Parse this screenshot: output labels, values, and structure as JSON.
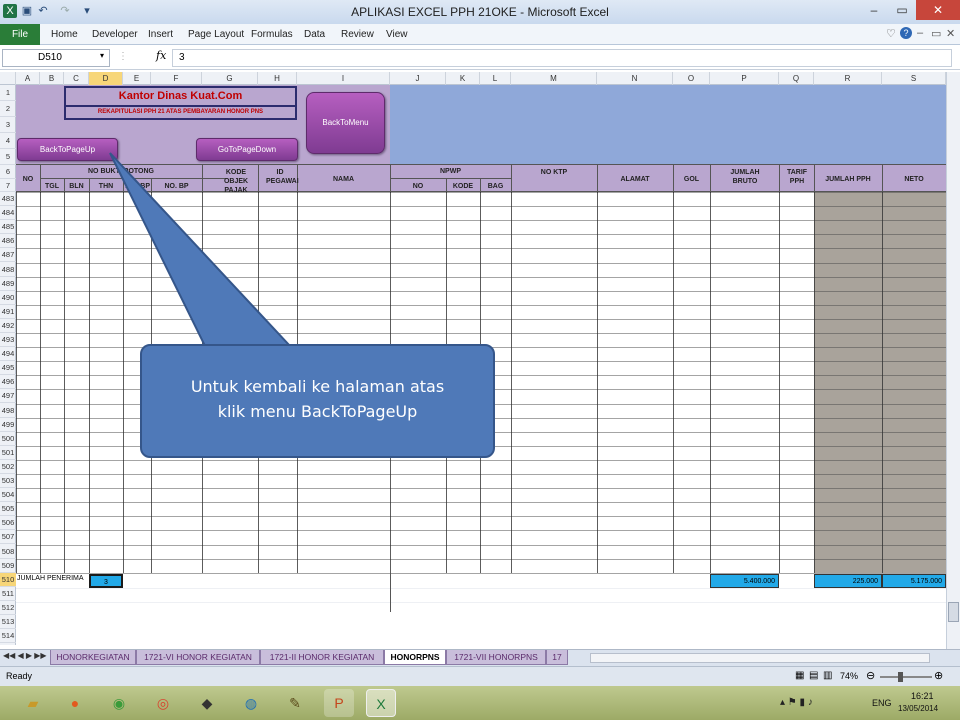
{
  "window": {
    "title": "APLIKASI EXCEL PPH 21OKE - Microsoft Excel",
    "minimize": "–",
    "restore": "▭",
    "close": "✕"
  },
  "ribbon": {
    "file": "File",
    "tabs": [
      "Home",
      "Developer",
      "Insert",
      "Page Layout",
      "Formulas",
      "Data",
      "Review",
      "View"
    ]
  },
  "formula_bar": {
    "name_box": "D510",
    "fx": "fx",
    "value": "3"
  },
  "columns": [
    "A",
    "B",
    "C",
    "D",
    "E",
    "F",
    "G",
    "H",
    "I",
    "J",
    "K",
    "L",
    "M",
    "N",
    "O",
    "P",
    "Q",
    "R",
    "S"
  ],
  "rows": [
    "1",
    "2",
    "3",
    "4",
    "5",
    "6",
    "7",
    "483",
    "484",
    "485",
    "486",
    "487",
    "488",
    "489",
    "490",
    "491",
    "492",
    "493",
    "494",
    "495",
    "496",
    "497",
    "498",
    "499",
    "500",
    "501",
    "502",
    "503",
    "504",
    "505",
    "506",
    "507",
    "508",
    "509",
    "510",
    "511",
    "512",
    "513",
    "514"
  ],
  "sheet": {
    "kantor": "Kantor Dinas Kuat.Com",
    "rekap": "REKAPITULASI PPH 21 ATAS PEMBAYARAN HONOR PNS",
    "btn_backtomenu": "BackToMenu",
    "btn_backtopageup": "BackToPageUp",
    "btn_gotopagedown": "GoToPageDown",
    "headers": {
      "no": "NO",
      "bukti_potong": "NO BUKTI POTONG",
      "tgl": "TGL",
      "bln": "BLN",
      "thn": "THN",
      "thn_bp": "THN.BP",
      "no_bp": "NO. BP",
      "kode_objek": "KODE OBJEK PAJAK",
      "id_pegawai": "ID PEGAWAI",
      "nama": "NAMA",
      "npwp": "NPWP",
      "npwp_no": "NO",
      "npwp_kode": "KODE",
      "npwp_bag": "BAG",
      "no_ktp": "NO KTP",
      "alamat": "ALAMAT",
      "gol": "GOL",
      "jumlah_bruto": "JUMLAH BRUTO",
      "tarif_pph": "TARIF PPH",
      "jumlah_pph": "JUMLAH PPH",
      "neto": "NETO"
    },
    "totals": {
      "label": "JUMLAH PENERIMA",
      "count": "3",
      "bruto": "5.400.000",
      "pph": "225.000",
      "neto": "5.175.000"
    }
  },
  "callout": {
    "line1": "Untuk kembali ke halaman atas",
    "line2": "klik menu BackToPageUp"
  },
  "sheet_tabs": [
    "HONORKEGIATAN",
    "1721-VI HONOR KEGIATAN",
    "1721-II HONOR KEGIATAN",
    "HONORPNS",
    "1721-VII HONORPNS",
    "17"
  ],
  "active_sheet": "HONORPNS",
  "status": {
    "ready": "Ready",
    "zoom": "74%"
  },
  "taskbar": {
    "lang": "ENG",
    "time": "16:21",
    "date": "13/05/2014"
  },
  "colors": {
    "header_purple": "#b9a6cf",
    "header_blue": "#8fa8d9",
    "callout_blue": "#4f79b8",
    "excel_green": "#2a7d38",
    "total_cyan": "#22a9e8"
  }
}
